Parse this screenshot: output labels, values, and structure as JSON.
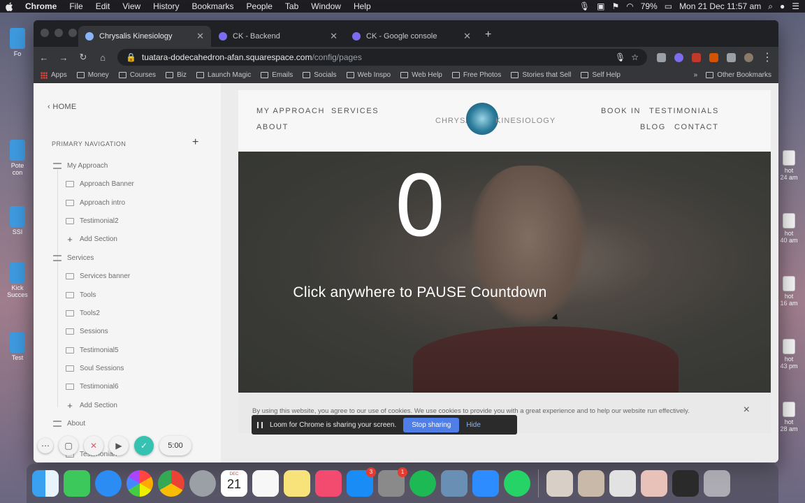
{
  "menubar": {
    "app": "Chrome",
    "items": [
      "File",
      "Edit",
      "View",
      "History",
      "Bookmarks",
      "People",
      "Tab",
      "Window",
      "Help"
    ],
    "battery": "79%",
    "datetime": "Mon 21 Dec  11:57 am"
  },
  "desktop_left": [
    "Fo",
    "Pote\ncon",
    "SSI",
    "Kick\nSucces",
    "Test"
  ],
  "desktop_right": [
    "hot\n24 am",
    "hot\n40 am",
    "hot\n16 am",
    "hot\n43 pm",
    "hot\n28 am"
  ],
  "tabs": [
    {
      "label": "Chrysalis Kinesiology"
    },
    {
      "label": "CK - Backend"
    },
    {
      "label": "CK - Google console"
    }
  ],
  "address": {
    "host": "tuatara-dodecahedron-afan.squarespace.com",
    "path": "/config/pages"
  },
  "bookmarks": {
    "apps": "Apps",
    "items": [
      "Money",
      "Courses",
      "Biz",
      "Launch Magic",
      "Emails",
      "Socials",
      "Web Inspo",
      "Web Help",
      "Free Photos",
      "Stories that Sell",
      "Self Help"
    ],
    "more": "»",
    "other": "Other Bookmarks"
  },
  "sidebar": {
    "home": "HOME",
    "section_title": "PRIMARY NAVIGATION",
    "pages": [
      {
        "label": "My Approach",
        "type": "page"
      },
      {
        "label": "Approach Banner",
        "type": "child"
      },
      {
        "label": "Approach intro",
        "type": "child"
      },
      {
        "label": "Testimonial2",
        "type": "child"
      },
      {
        "label": "Add Section",
        "type": "add"
      },
      {
        "label": "Services",
        "type": "page"
      },
      {
        "label": "Services banner",
        "type": "child"
      },
      {
        "label": "Tools",
        "type": "child"
      },
      {
        "label": "Tools2",
        "type": "child"
      },
      {
        "label": "Sessions",
        "type": "child"
      },
      {
        "label": "Testimonial5",
        "type": "child"
      },
      {
        "label": "Soul Sessions",
        "type": "child"
      },
      {
        "label": "Testimonial6",
        "type": "child"
      },
      {
        "label": "Add Section",
        "type": "add"
      },
      {
        "label": "About",
        "type": "page"
      },
      {
        "label": "Testimonial7",
        "type": "child"
      }
    ]
  },
  "site": {
    "nav": {
      "my_approach": "MY APPROACH",
      "services": "SERVICES",
      "about": "ABOUT",
      "book_in": "BOOK IN",
      "testimonials": "TESTIMONIALS",
      "blog": "BLOG",
      "contact": "CONTACT"
    },
    "logo_left": "CHRYSALIS",
    "logo_right": "KINESIOLOGY"
  },
  "countdown": {
    "number": "0",
    "message": "Click anywhere to PAUSE Countdown"
  },
  "cookie": {
    "text": "By using this website, you agree to our use of cookies. We use cookies to provide you with a great experience and to help our website run effectively.",
    "close": "×"
  },
  "loom": {
    "message": "Loom for Chrome is sharing your screen.",
    "stop": "Stop sharing",
    "hide": "Hide",
    "timer": "5:00"
  },
  "dock": {
    "calendar_month": "DEC",
    "calendar_day": "21",
    "appstore_badge": "3",
    "prefs_badge": "1"
  },
  "colors": {
    "accent_blue": "#4f7ee8",
    "loom_done": "#35c2b0",
    "badge_red": "#e53b30"
  }
}
